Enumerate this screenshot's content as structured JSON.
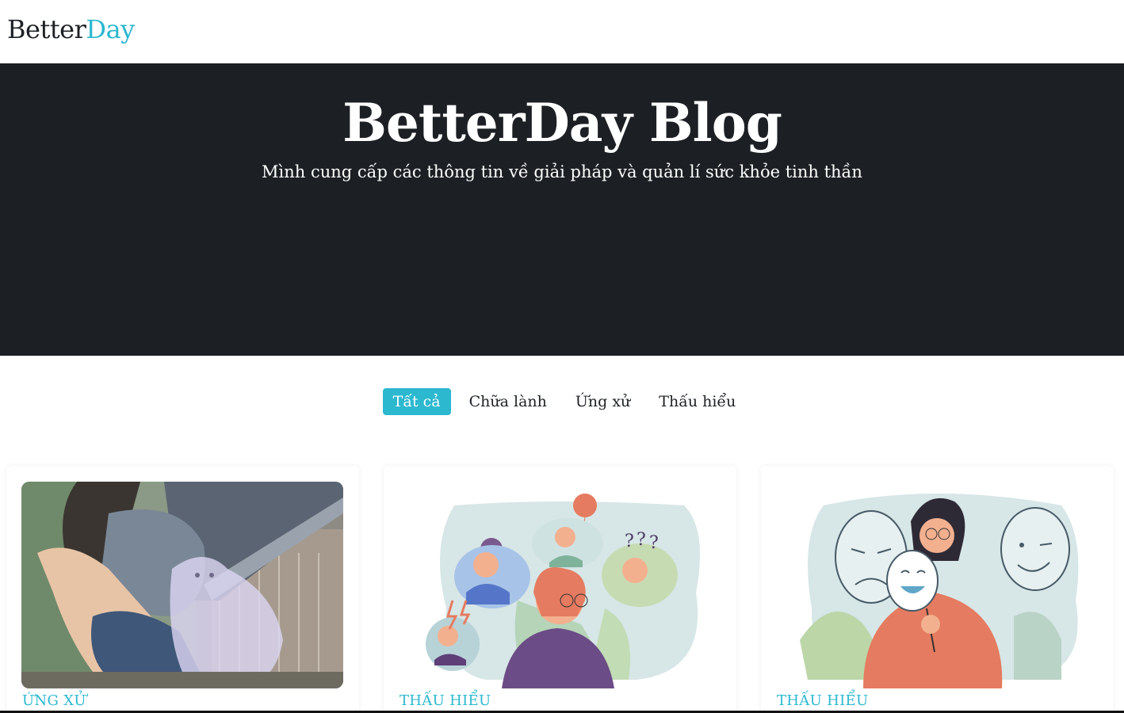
{
  "nav": {
    "brand_main": "Better",
    "brand_accent": "Day"
  },
  "hero": {
    "title": "BetterDay Blog",
    "subtitle": "Mình cung cấp các thông tin về giải pháp và quản lí sức khỏe tinh thần"
  },
  "filters": {
    "all": "Tất cả",
    "healing": "Chữa lành",
    "behavior": "Ứng xử",
    "understanding": "Thấu hiểu",
    "active": "all"
  },
  "posts": [
    {
      "category": "ỨNG XỬ",
      "image": "girl-with-ghost-cat-illustration"
    },
    {
      "category": "THẤU HIỂU",
      "image": "woman-many-emotions-illustration"
    },
    {
      "category": "THẤU HIỂU",
      "image": "woman-with-masks-illustration"
    }
  ],
  "colors": {
    "accent": "#2cb8cf",
    "hero_bg": "#1c1f23",
    "text": "#1d2125"
  }
}
